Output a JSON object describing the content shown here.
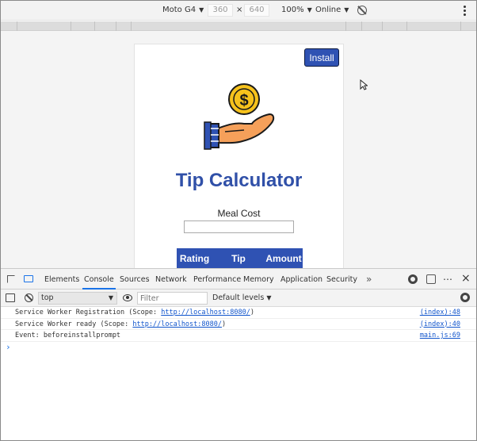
{
  "device_toolbar": {
    "device": "Moto G4",
    "width": "360",
    "times": "×",
    "height": "640",
    "zoom": "100%",
    "network": "Online"
  },
  "app": {
    "install_label": "Install",
    "title": "Tip Calculator",
    "meal_label": "Meal Cost",
    "meal_value": "",
    "table_headers": [
      "Rating",
      "Tip",
      "Amount"
    ],
    "colors": {
      "accent": "#2f52b3",
      "title": "#3050a8",
      "coin": "#f6c21c",
      "hand": "#f5a05a"
    }
  },
  "devtools": {
    "tabs": [
      "Elements",
      "Console",
      "Sources",
      "Network",
      "Performance",
      "Memory",
      "Application",
      "Security"
    ],
    "active_tab": "Console",
    "context": "top",
    "filter_placeholder": "Filter",
    "levels": "Default levels",
    "logs": [
      {
        "prefix": "Service Worker Registration (Scope: ",
        "link": "http://localhost:8080/",
        "suffix": ")",
        "source": "(index):48"
      },
      {
        "prefix": "Service Worker ready (Scope: ",
        "link": "http://localhost:8080/",
        "suffix": ")",
        "source": "(index):40"
      },
      {
        "prefix": "Event: beforeinstallprompt",
        "link": "",
        "suffix": "",
        "source": "main.js:69"
      }
    ],
    "prompt": "›"
  }
}
